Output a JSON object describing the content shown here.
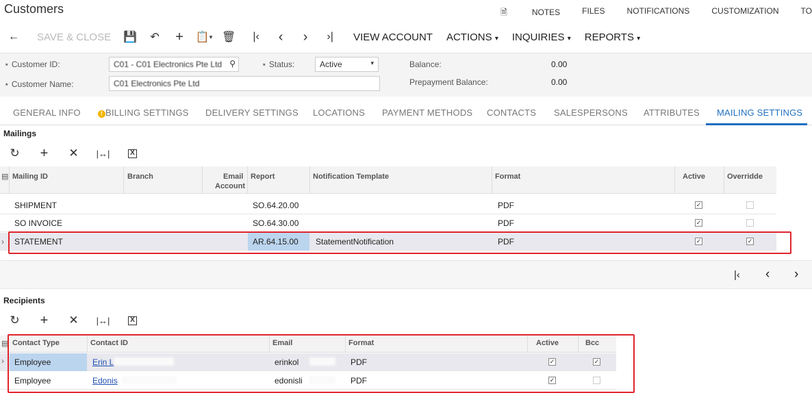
{
  "header": {
    "title": "Customers",
    "links": [
      {
        "label": "NOTES",
        "icon": "note-icon"
      },
      {
        "label": "FILES"
      },
      {
        "label": "NOTIFICATIONS"
      },
      {
        "label": "CUSTOMIZATION"
      },
      {
        "label": "TO"
      }
    ]
  },
  "toolbar": {
    "back_icon": "⇦",
    "save_close": "SAVE & CLOSE",
    "view_account": "VIEW ACCOUNT",
    "actions": "ACTIONS",
    "inquiries": "INQUIRIES",
    "reports": "REPORTS"
  },
  "summary": {
    "customer_id_label": "Customer ID:",
    "customer_id_value": "C01 - C01 Electronics Pte Ltd",
    "customer_name_label": "Customer Name:",
    "customer_name_value": "C01 Electronics Pte Ltd",
    "status_label": "Status:",
    "status_value": "Active",
    "balance_label": "Balance:",
    "balance_value": "0.00",
    "prepayment_label": "Prepayment Balance:",
    "prepayment_value": "0.00"
  },
  "tabs": [
    {
      "label": "GENERAL INFO"
    },
    {
      "label": "BILLING SETTINGS",
      "warning": true
    },
    {
      "label": "DELIVERY SETTINGS"
    },
    {
      "label": "LOCATIONS"
    },
    {
      "label": "PAYMENT METHODS"
    },
    {
      "label": "CONTACTS"
    },
    {
      "label": "SALESPERSONS"
    },
    {
      "label": "ATTRIBUTES"
    },
    {
      "label": "MAILING SETTINGS",
      "active": true
    }
  ],
  "mailings": {
    "title": "Mailings",
    "columns": {
      "mailing_id": "Mailing ID",
      "branch": "Branch",
      "email_account_1": "Email",
      "email_account_2": "Account",
      "report": "Report",
      "template": "Notification Template",
      "format": "Format",
      "active": "Active",
      "override": "Overridde"
    },
    "rows": [
      {
        "mailing_id": "SHIPMENT",
        "report": "SO.64.20.00",
        "template": "",
        "format": "PDF",
        "active": true,
        "override": false
      },
      {
        "mailing_id": "SO INVOICE",
        "report": "SO.64.30.00",
        "template": "",
        "format": "PDF",
        "active": true,
        "override": false
      },
      {
        "mailing_id": "STATEMENT",
        "report": "AR.64.15.00",
        "template": "StatementNotification",
        "format": "PDF",
        "active": true,
        "override": true
      }
    ]
  },
  "recipients": {
    "title": "Recipients",
    "columns": {
      "contact_type": "Contact Type",
      "contact_id": "Contact ID",
      "email": "Email",
      "format": "Format",
      "active": "Active",
      "bcc": "Bcc"
    },
    "rows": [
      {
        "contact_type": "Employee",
        "contact_id": "Erin L",
        "email": "erinkol",
        "format": "PDF",
        "active": true,
        "bcc": true
      },
      {
        "contact_type": "Employee",
        "contact_id": "Edonis",
        "email": "edonisli",
        "format": "PDF",
        "active": true,
        "bcc": false
      }
    ]
  },
  "colors": {
    "accent": "#1f6fbf",
    "highlight": "#e0242c",
    "selected_row": "#e8e8ee",
    "report_cell": "#bcd5ef"
  }
}
